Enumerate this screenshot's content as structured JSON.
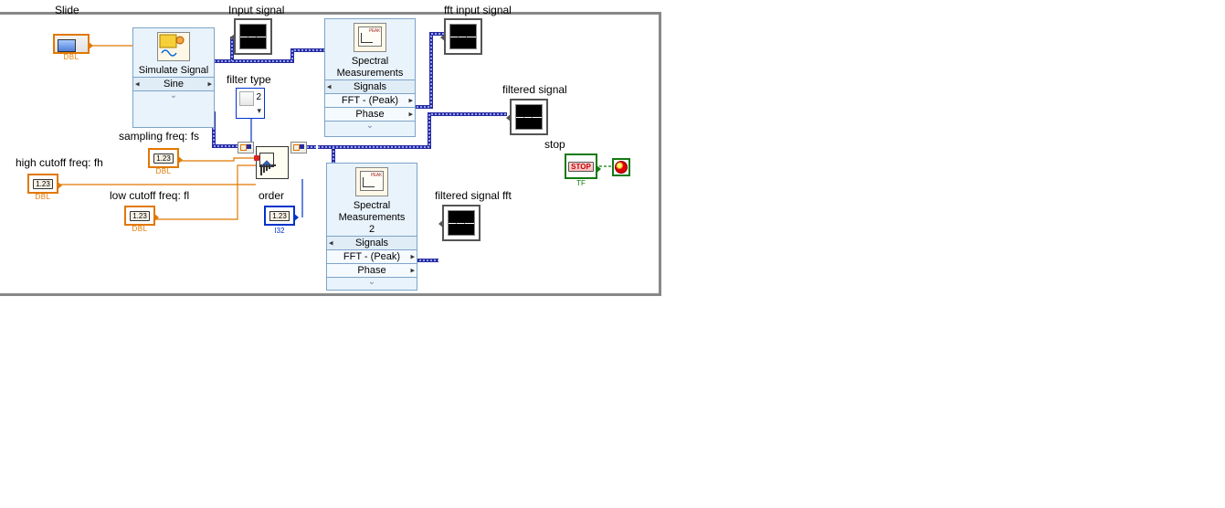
{
  "labels": {
    "slide": "Slide",
    "input_signal": "Input signal",
    "fft_input": "fft input signal",
    "filter_type": "filter type",
    "sampling_freq": "sampling freq: fs",
    "high_cutoff": "high cutoff freq: fh",
    "low_cutoff": "low cutoff freq: fl",
    "order": "order",
    "filtered_signal": "filtered signal",
    "filtered_fft": "filtered signal fft",
    "stop": "stop"
  },
  "terminals": {
    "dbl_badge": "1.23",
    "dbl_tag": "DBL",
    "i32_tag": "I32",
    "tf_tag": "TF",
    "stop_badge": "STOP",
    "ring_value": "2"
  },
  "express": {
    "simulate": {
      "title": "Simulate Signal",
      "row1": "Sine"
    },
    "spec1": {
      "title1": "Spectral",
      "title2": "Measurements",
      "rows": [
        "Signals",
        "FFT - (Peak)",
        "Phase"
      ]
    },
    "spec2": {
      "title1": "Spectral",
      "title2": "Measurements",
      "title3": "2",
      "rows": [
        "Signals",
        "FFT - (Peak)",
        "Phase"
      ]
    }
  }
}
